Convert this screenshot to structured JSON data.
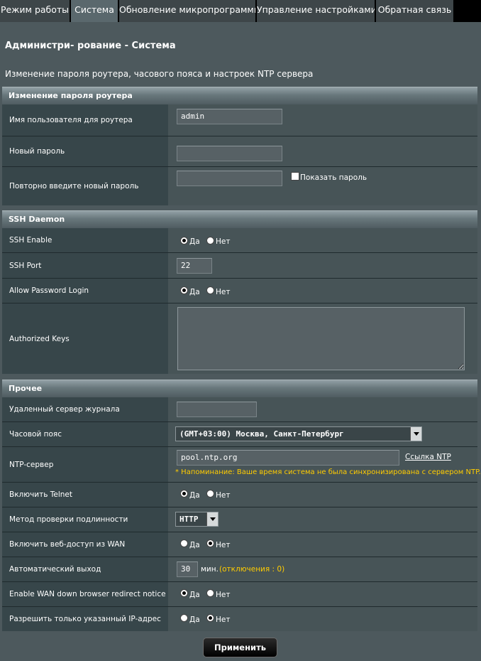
{
  "tabs": [
    "Режим работы",
    "Система",
    "Обновление микропрограммы",
    "Управление настройками",
    "Обратная связь"
  ],
  "page": {
    "title": "Администри- рование - Система",
    "description": "Изменение пароля роутера, часового пояса и настроек NTP сервера"
  },
  "password_section": {
    "header": "Изменение пароля роутера",
    "username_label": "Имя пользователя для роутера",
    "username_value": "admin",
    "new_password_label": "Новый пароль",
    "repeat_password_label": "Повторно введите новый пароль",
    "show_password_label": "Показать пароль"
  },
  "ssh_section": {
    "header": "SSH Daemon",
    "enable_label": "SSH Enable",
    "port_label": "SSH Port",
    "port_value": "22",
    "allow_password_label": "Allow Password Login",
    "authorized_keys_label": "Authorized Keys"
  },
  "radio": {
    "yes": "Да",
    "no": "Нет"
  },
  "misc_section": {
    "header": "Прочее",
    "log_server_label": "Удаленный сервер журнала",
    "timezone_label": "Часовой пояс",
    "timezone_value": "(GMT+03:00) Москва, Санкт-Петербург",
    "ntp_label": "NTP-сервер",
    "ntp_value": "pool.ntp.org",
    "ntp_link": "Ссылка NTP",
    "ntp_note": "* Напоминание: Ваше время система не была синхронизирована с сервером NTP.",
    "telnet_label": "Включить Telnet",
    "auth_method_label": "Метод проверки подлинности",
    "auth_method_value": "HTTP",
    "wan_access_label": "Включить веб-доступ из WAN",
    "auto_logout_label": "Автоматический выход",
    "auto_logout_value": "30",
    "auto_logout_unit": "мин.",
    "auto_logout_note": "(отключения : 0)",
    "wan_redirect_label": "Enable WAN down browser redirect notice",
    "ip_only_label": "Разрешить только указанный IP-адрес"
  },
  "apply_button": "Применить"
}
